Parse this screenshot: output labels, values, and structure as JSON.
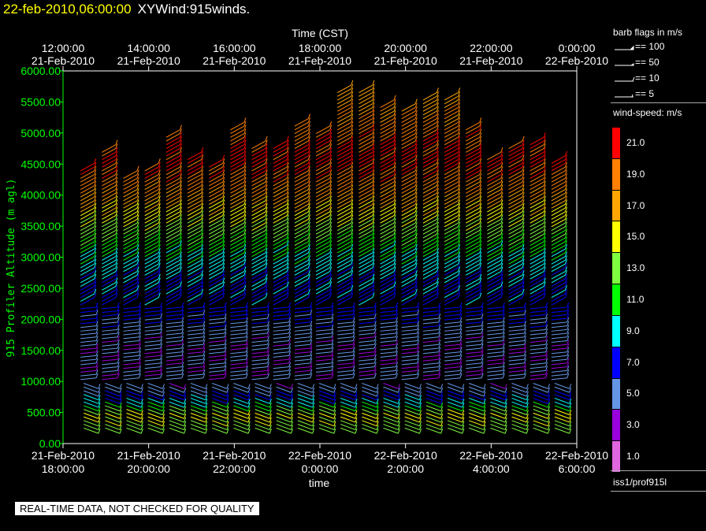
{
  "header": {
    "timestamp": "22-feb-2010,06:00:00",
    "title": "XYWind:915winds."
  },
  "quality_note": "REAL-TIME DATA, NOT CHECKED FOR QUALITY",
  "legend": {
    "barb_title": "barb flags in m/s",
    "barb_items": [
      "== 100",
      "== 50",
      "== 10",
      "== 5"
    ],
    "speed_title": "wind-speed: m/s",
    "speed_bins": [
      {
        "label": "21.0",
        "color": "#ff0000"
      },
      {
        "label": "19.0",
        "color": "#ff8000"
      },
      {
        "label": "17.0",
        "color": "#ffa500"
      },
      {
        "label": "15.0",
        "color": "#ffff00"
      },
      {
        "label": "13.0",
        "color": "#80ff40"
      },
      {
        "label": "11.0",
        "color": "#00ff00"
      },
      {
        "label": "9.0",
        "color": "#00ffff"
      },
      {
        "label": "7.0",
        "color": "#0000ff"
      },
      {
        "label": "5.0",
        "color": "#6496e6"
      },
      {
        "label": "3.0",
        "color": "#9900dd"
      },
      {
        "label": "1.0",
        "color": "#e066e0"
      }
    ],
    "source": "iss1/prof915l"
  },
  "chart_data": {
    "type": "wind-barb",
    "top_axis_label": "Time (CST)",
    "top_ticks": [
      {
        "time": "12:00:00",
        "date": "21-Feb-2010"
      },
      {
        "time": "14:00:00",
        "date": "21-Feb-2010"
      },
      {
        "time": "16:00:00",
        "date": "21-Feb-2010"
      },
      {
        "time": "18:00:00",
        "date": "21-Feb-2010"
      },
      {
        "time": "20:00:00",
        "date": "21-Feb-2010"
      },
      {
        "time": "22:00:00",
        "date": "21-Feb-2010"
      },
      {
        "time": "0:00:00",
        "date": "22-Feb-2010"
      }
    ],
    "bottom_ticks": [
      {
        "date": "21-Feb-2010",
        "time": "18:00:00"
      },
      {
        "date": "21-Feb-2010",
        "time": "20:00:00"
      },
      {
        "date": "21-Feb-2010",
        "time": "22:00:00"
      },
      {
        "date": "22-Feb-2010",
        "time": "0:00:00"
      },
      {
        "date": "22-Feb-2010",
        "time": "2:00:00"
      },
      {
        "date": "22-Feb-2010",
        "time": "4:00:00"
      },
      {
        "date": "22-Feb-2010",
        "time": "6:00:00"
      }
    ],
    "xlabel": "time",
    "ylabel": "915 Profiler Altitude (m agl)",
    "ylim": [
      0,
      6000
    ],
    "y_ticks": [
      "0.00",
      "500.00",
      "1000.00",
      "1500.00",
      "2000.00",
      "2500.00",
      "3000.00",
      "3500.00",
      "4000.00",
      "4500.00",
      "5000.00",
      "5500.00",
      "6000.00"
    ],
    "xlim": [
      "2010-02-21T18:00",
      "2010-02-22T06:00"
    ],
    "profiles": [
      {
        "time": "2010-02-21T18:40",
        "top": 4400
      },
      {
        "time": "2010-02-21T19:10",
        "top": 4700
      },
      {
        "time": "2010-02-21T19:40",
        "top": 4300
      },
      {
        "time": "2010-02-21T20:10",
        "top": 4400
      },
      {
        "time": "2010-02-21T20:40",
        "top": 4950
      },
      {
        "time": "2010-02-21T21:10",
        "top": 4600
      },
      {
        "time": "2010-02-21T21:40",
        "top": 4450
      },
      {
        "time": "2010-02-21T22:10",
        "top": 5100
      },
      {
        "time": "2010-02-21T22:40",
        "top": 4750
      },
      {
        "time": "2010-02-21T23:10",
        "top": 4750
      },
      {
        "time": "2010-02-21T23:40",
        "top": 5150
      },
      {
        "time": "2010-02-22T00:10",
        "top": 5000
      },
      {
        "time": "2010-02-22T00:40",
        "top": 5650
      },
      {
        "time": "2010-02-22T01:10",
        "top": 5700
      },
      {
        "time": "2010-02-22T01:40",
        "top": 5450
      },
      {
        "time": "2010-02-22T02:10",
        "top": 5400
      },
      {
        "time": "2010-02-22T02:40",
        "top": 5550
      },
      {
        "time": "2010-02-22T03:10",
        "top": 5550
      },
      {
        "time": "2010-02-22T03:40",
        "top": 5050
      },
      {
        "time": "2010-02-22T04:10",
        "top": 4600
      },
      {
        "time": "2010-02-22T04:40",
        "top": 4800
      },
      {
        "time": "2010-02-22T05:10",
        "top": 4850
      },
      {
        "time": "2010-02-22T05:40",
        "top": 4550
      }
    ],
    "speed_profile_shape": [
      {
        "alt": 300,
        "speed": 13
      },
      {
        "alt": 500,
        "speed": 15
      },
      {
        "alt": 700,
        "speed": 9
      },
      {
        "alt": 900,
        "speed": 5
      },
      {
        "alt": 1200,
        "speed": 4
      },
      {
        "alt": 1500,
        "speed": 4
      },
      {
        "alt": 1800,
        "speed": 5
      },
      {
        "alt": 2100,
        "speed": 7
      },
      {
        "alt": 2600,
        "speed": 8
      },
      {
        "alt": 3000,
        "speed": 10
      },
      {
        "alt": 3500,
        "speed": 14
      },
      {
        "alt": 4000,
        "speed": 18
      },
      {
        "alt": 4500,
        "speed": 21
      },
      {
        "alt": 5500,
        "speed": 17
      }
    ]
  }
}
